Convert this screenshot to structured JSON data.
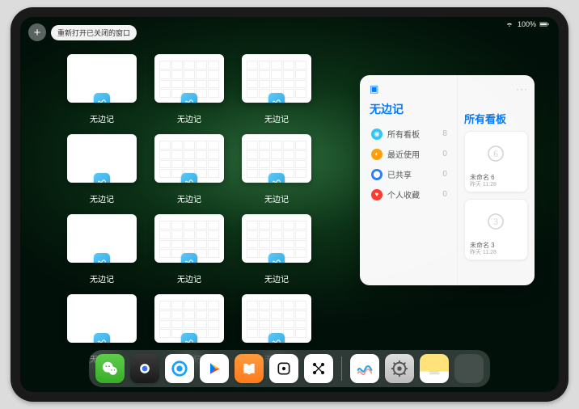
{
  "status": {
    "battery": "100%"
  },
  "topbar": {
    "plus_label": "+",
    "reopen_label": "重新打开已关闭的窗口"
  },
  "app_name": "无边记",
  "expose_windows": [
    {
      "label": "无边记",
      "kind": "blank"
    },
    {
      "label": "无边记",
      "kind": "grid"
    },
    {
      "label": "无边记",
      "kind": "grid"
    },
    {
      "label": "无边记",
      "kind": "blank"
    },
    {
      "label": "无边记",
      "kind": "grid"
    },
    {
      "label": "无边记",
      "kind": "grid"
    },
    {
      "label": "无边记",
      "kind": "blank"
    },
    {
      "label": "无边记",
      "kind": "grid"
    },
    {
      "label": "无边记",
      "kind": "grid"
    },
    {
      "label": "无边记",
      "kind": "blank"
    },
    {
      "label": "无边记",
      "kind": "grid"
    },
    {
      "label": "无边记",
      "kind": "grid"
    }
  ],
  "popover": {
    "left_title": "无边记",
    "right_title": "所有看板",
    "categories": [
      {
        "icon_color": "#32c6f4",
        "name": "所有看板",
        "count": 8
      },
      {
        "icon_color": "#ff9f0a",
        "name": "最近使用",
        "count": 0
      },
      {
        "icon_color": "#2b7ef5",
        "name": "已共享",
        "count": 0
      },
      {
        "icon_color": "#ff3b30",
        "name": "个人收藏",
        "count": 0
      }
    ],
    "boards": [
      {
        "title": "未命名 6",
        "subtitle": "昨天 11:28",
        "digit": "6"
      },
      {
        "title": "未命名 3",
        "subtitle": "昨天 11:28",
        "digit": "3"
      }
    ]
  },
  "dock": {
    "items": [
      {
        "name": "wechat"
      },
      {
        "name": "camera"
      },
      {
        "name": "qq"
      },
      {
        "name": "play"
      },
      {
        "name": "books"
      },
      {
        "name": "dice"
      },
      {
        "name": "nodes"
      }
    ],
    "recent": [
      {
        "name": "freeform"
      },
      {
        "name": "settings"
      },
      {
        "name": "notes"
      },
      {
        "name": "folder"
      }
    ]
  }
}
